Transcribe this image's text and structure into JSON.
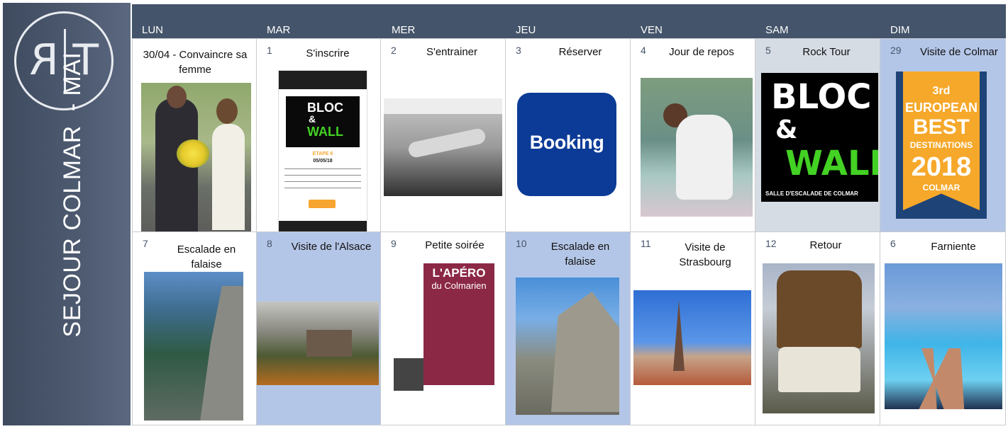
{
  "sidebar": {
    "logo_left": "R",
    "logo_right": "T",
    "title": "SEJOUR COLMAR  - MAI"
  },
  "days": [
    "LUN",
    "MAR",
    "MER",
    "JEU",
    "VEN",
    "SAM",
    "DIM"
  ],
  "row1": [
    {
      "num": "",
      "title": "30/04 - Convaincre sa femme",
      "image": "couple-with-flowers-photo"
    },
    {
      "num": "1",
      "title": "S'inscrire",
      "image": "bloc-and-wall-website-screenshot"
    },
    {
      "num": "2",
      "title": "S'entrainer",
      "image": "climbing-training-photo"
    },
    {
      "num": "3",
      "title": "Réserver",
      "image": "booking-logo"
    },
    {
      "num": "4",
      "title": "Jour de repos",
      "image": "sleeping-child-photo"
    },
    {
      "num": "5",
      "title": "Rock Tour",
      "image": "bloc-and-wall-logo"
    },
    {
      "num": "29",
      "title": "Visite de Colmar",
      "image": "european-best-destinations-banner"
    }
  ],
  "row2": [
    {
      "num": "7",
      "title": "Escalade en falaise",
      "image": "cliff-climbing-photo"
    },
    {
      "num": "8",
      "title": "Visite de l'Alsace",
      "image": "castle-landscape-photo"
    },
    {
      "num": "9",
      "title": "Petite soirée",
      "image": "apero-poster"
    },
    {
      "num": "10",
      "title": "Escalade en falaise",
      "image": "rock-climbing-photo"
    },
    {
      "num": "11",
      "title": "Visite de Strasbourg",
      "image": "strasbourg-cathedral-photo"
    },
    {
      "num": "12",
      "title": "Retour",
      "image": "overloaded-car-photo"
    },
    {
      "num": "6",
      "title": "Farniente",
      "image": "pool-relaxing-photo"
    }
  ],
  "phone": {
    "logo_line1": "BLOC",
    "logo_line2": "&",
    "logo_line3": "WALL",
    "step": "ETAPE 6",
    "date": "05/05/18"
  },
  "bloc_logo": {
    "line1": "BLOC",
    "line2": "&",
    "line3": "WALL",
    "subtitle": "SALLE D'ESCALADE DE COLMAR"
  },
  "booking": {
    "text": "Booking"
  },
  "ebd": {
    "edition": "3rd",
    "line1": "EUROPEAN",
    "line2": "BEST",
    "line3": "DESTINATIONS",
    "year": "2018",
    "city": "COLMAR"
  },
  "apero": {
    "title": "L'APÉRO",
    "subtitle": "du Colmarien"
  },
  "colors": {
    "header": "#44546a",
    "sidebar": "#4d5a70",
    "cell_blue": "#b4c6e7",
    "cell_grey": "#d6dce4"
  }
}
